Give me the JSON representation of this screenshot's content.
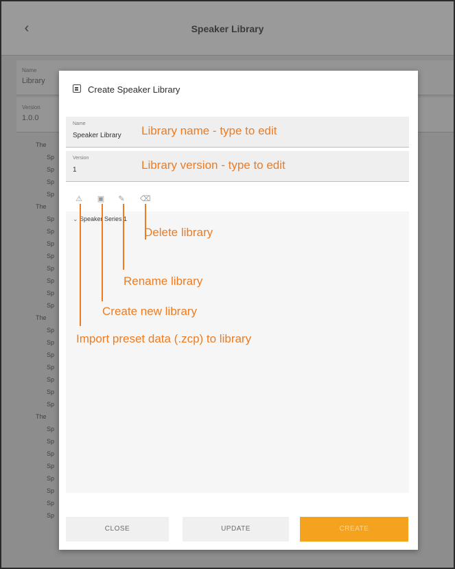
{
  "app": {
    "title": "Speaker Library",
    "back_icon": "chevron-left-icon",
    "fields": [
      {
        "label": "Name",
        "value": "Library"
      },
      {
        "label": "Version",
        "value": "1.0.0"
      }
    ],
    "tree": [
      "The",
      "Sp",
      "Sp",
      "Sp",
      "Sp",
      "The",
      "Sp",
      "Sp",
      "Sp",
      "Sp",
      "Sp",
      "Sp",
      "Sp",
      "Sp",
      "The",
      "Sp",
      "Sp",
      "Sp",
      "Sp",
      "Sp",
      "Sp",
      "Sp",
      "The",
      "Sp",
      "Sp",
      "Sp",
      "Sp",
      "Sp",
      "Sp",
      "Sp",
      "Sp"
    ]
  },
  "dialog": {
    "title": "Create Speaker Library",
    "title_icon": "library-icon",
    "name_field": {
      "label": "Name",
      "value": "Speaker Library",
      "note": "Library name - type to edit"
    },
    "version_field": {
      "label": "Version",
      "value": "1",
      "note": "Library version - type to edit"
    },
    "toolbar": {
      "import_icon": "warning-icon",
      "create_icon": "folder-icon",
      "rename_icon": "pencil-icon",
      "delete_icon": "trash-icon"
    },
    "tree_item": "Speaker Series 1",
    "callouts": {
      "delete": "Delete library",
      "rename": "Rename library",
      "create": "Create new library",
      "import": "Import preset data (.zcp) to library"
    },
    "buttons": {
      "close": "CLOSE",
      "update": "UPDATE",
      "create": "CREATE"
    },
    "accent_color": "#F5A21F",
    "annotation_color": "#EE7B20"
  }
}
